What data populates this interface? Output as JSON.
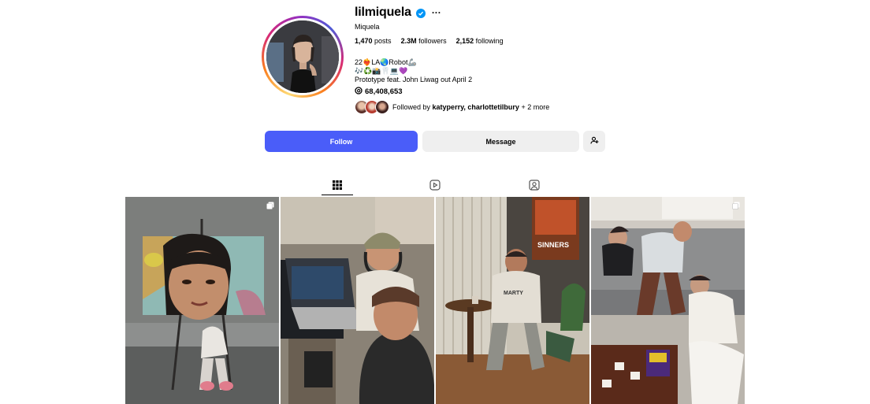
{
  "profile": {
    "username": "lilmiquela",
    "full_name": "Miquela",
    "stats": {
      "posts": "1,470",
      "posts_label": "posts",
      "followers": "2.3M",
      "followers_label": "followers",
      "following": "2,152",
      "following_label": "following"
    },
    "bio_line1": "22❤️‍🔥LA🌏Robot🦾",
    "bio_line2": "🎶♻️📸🦷💻💜",
    "bio_line3": "Prototype feat. John Liwag out April 2",
    "threads_count": "68,408,653",
    "followed_by_prefix": "Followed by",
    "followed_by_names": "katyperry, charlottetilbury",
    "followed_by_more": "+ 2 more"
  },
  "actions": {
    "follow_label": "Follow",
    "message_label": "Message"
  },
  "tabs": [
    {
      "icon": "grid-icon",
      "active": true
    },
    {
      "icon": "reels-icon",
      "active": false
    },
    {
      "icon": "tagged-icon",
      "active": false
    }
  ],
  "colors": {
    "follow_button": "#4a5df9",
    "secondary_button": "#efefef",
    "verified": "#0095f6"
  }
}
